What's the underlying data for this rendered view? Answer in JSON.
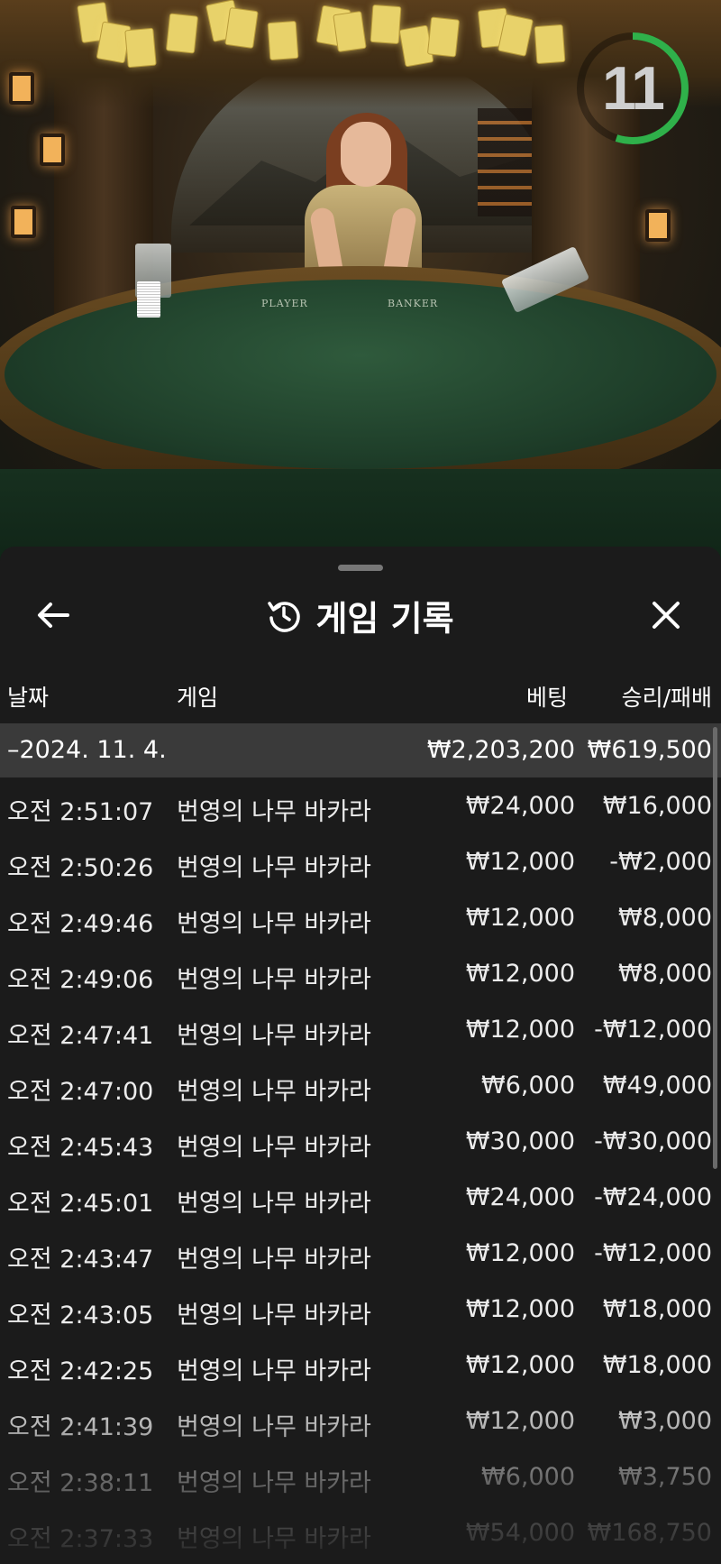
{
  "timer": {
    "value": "11",
    "fraction_remaining": 0.55,
    "ring_color": "#2fb04a"
  },
  "table_felt": {
    "left_label": "PLAYER",
    "right_label": "BANKER"
  },
  "history": {
    "title": "게임 기록",
    "title_icon": "history-icon",
    "back_icon": "arrow-left-icon",
    "close_icon": "close-icon",
    "columns": {
      "date": "날짜",
      "game": "게임",
      "bet": "베팅",
      "result": "승리/패배"
    },
    "summary": {
      "date": "–2024. 11. 4.",
      "bet": "₩2,203,200",
      "result": "₩619,500"
    },
    "rows": [
      {
        "time": "오전 2:51:07",
        "game": "번영의 나무 바카라",
        "bet": "₩24,000",
        "result": "₩16,000"
      },
      {
        "time": "오전 2:50:26",
        "game": "번영의 나무 바카라",
        "bet": "₩12,000",
        "result": "-₩2,000"
      },
      {
        "time": "오전 2:49:46",
        "game": "번영의 나무 바카라",
        "bet": "₩12,000",
        "result": "₩8,000"
      },
      {
        "time": "오전 2:49:06",
        "game": "번영의 나무 바카라",
        "bet": "₩12,000",
        "result": "₩8,000"
      },
      {
        "time": "오전 2:47:41",
        "game": "번영의 나무 바카라",
        "bet": "₩12,000",
        "result": "-₩12,000"
      },
      {
        "time": "오전 2:47:00",
        "game": "번영의 나무 바카라",
        "bet": "₩6,000",
        "result": "₩49,000"
      },
      {
        "time": "오전 2:45:43",
        "game": "번영의 나무 바카라",
        "bet": "₩30,000",
        "result": "-₩30,000"
      },
      {
        "time": "오전 2:45:01",
        "game": "번영의 나무 바카라",
        "bet": "₩24,000",
        "result": "-₩24,000"
      },
      {
        "time": "오전 2:43:47",
        "game": "번영의 나무 바카라",
        "bet": "₩12,000",
        "result": "-₩12,000"
      },
      {
        "time": "오전 2:43:05",
        "game": "번영의 나무 바카라",
        "bet": "₩12,000",
        "result": "₩18,000"
      },
      {
        "time": "오전 2:42:25",
        "game": "번영의 나무 바카라",
        "bet": "₩12,000",
        "result": "₩18,000"
      },
      {
        "time": "오전 2:41:39",
        "game": "번영의 나무 바카라",
        "bet": "₩12,000",
        "result": "₩3,000"
      },
      {
        "time": "오전 2:38:11",
        "game": "번영의 나무 바카라",
        "bet": "₩6,000",
        "result": "₩3,750"
      },
      {
        "time": "오전 2:37:33",
        "game": "번영의 나무 바카라",
        "bet": "₩54,000",
        "result": "₩168,750"
      }
    ]
  }
}
